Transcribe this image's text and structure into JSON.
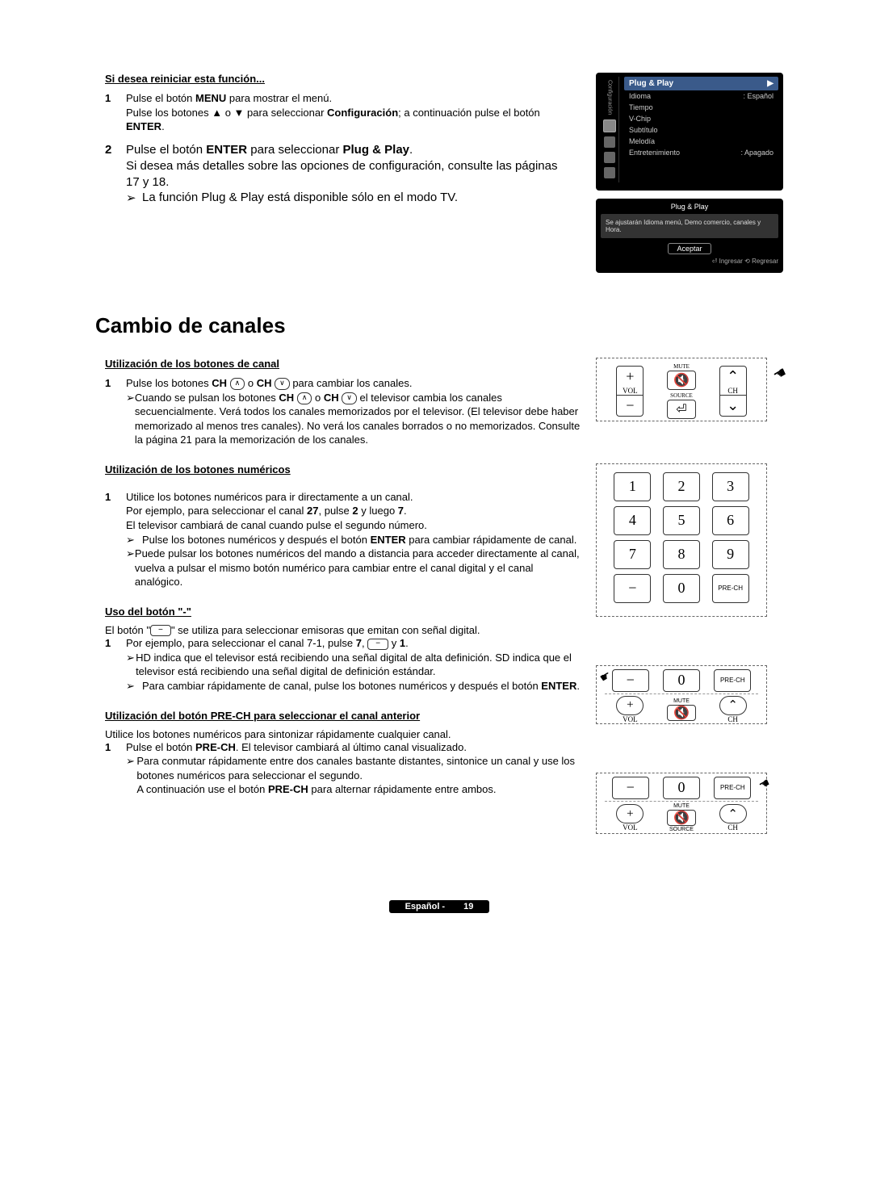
{
  "s1": {
    "heading": "Si desea reiniciar esta función...",
    "step1_num": "1",
    "step1_l1a": "Pulse el botón ",
    "step1_l1b": "MENU",
    "step1_l1c": " para mostrar el menú.",
    "step1_l2a": "Pulse los botones ▲ o ▼ para seleccionar ",
    "step1_l2b": "Configuración",
    "step1_l2c": "; a continuación pulse el botón ",
    "step1_l2d": "ENTER",
    "step1_l2e": ".",
    "step2_num": "2",
    "step2_l1a": "Pulse el botón ",
    "step2_l1b": "ENTER",
    "step2_l1c": " para seleccionar ",
    "step2_l1d": "Plug & Play",
    "step2_l1e": ".",
    "step2_l2": "Si desea más detalles sobre las opciones de configuración, consulte las páginas 17 y 18.",
    "step2_note": "La función Plug & Play está disponible sólo en el modo TV."
  },
  "osd": {
    "sidebar": "Configuración",
    "highlight": "Plug & Play",
    "arrow": "▶",
    "row1a": "Idioma",
    "row1b": ": Español",
    "row2": "Tiempo",
    "row3": "V-Chip",
    "row4": "Subtítulo",
    "row5": "Melodía",
    "row6a": "Entretenimiento",
    "row6b": ": Apagado"
  },
  "osd2": {
    "title": "Plug & Play",
    "msg": "Se ajustarán Idioma menú, Demo comercio, canales y Hora.",
    "btn": "Aceptar",
    "footer": "⏎ Ingresar  ⟲ Regresar"
  },
  "main_heading": "Cambio de canales",
  "s2": {
    "h1": "Utilización de los botones de canal",
    "n1": "1",
    "l1a": "Pulse los botones ",
    "l1b": "CH",
    "l1c": " o ",
    "l1d": "CH",
    "l1e": " para cambiar los canales.",
    "note1a": "Cuando se pulsan los botones ",
    "note1b": "CH",
    "note1c": " o ",
    "note1d": "CH",
    "note1e": " el televisor cambia los canales secuencialmente. Verá todos los canales memorizados por el televisor. (El televisor debe haber memorizado al menos tres canales). No verá los canales borrados o no memorizados. Consulte la página 21 para la memorización de los canales."
  },
  "s3": {
    "h": "Utilización de los botones numéricos",
    "n1": "1",
    "l1": "Utilice los botones numéricos para ir directamente a un canal.",
    "l2a": "Por ejemplo, para seleccionar el canal ",
    "l2b": "27",
    "l2c": ", pulse ",
    "l2d": "2",
    "l2e": " y luego ",
    "l2f": "7",
    "l2g": ".",
    "l3": "El televisor cambiará de canal cuando pulse el segundo número.",
    "a1a": "Pulse los botones numéricos y después el botón ",
    "a1b": "ENTER",
    "a1c": " para cambiar rápidamente de canal.",
    "a2": "Puede pulsar los botones numéricos del mando a distancia para acceder directamente al canal, vuelva a pulsar el mismo botón numérico para cambiar entre el canal digital y el canal analógico."
  },
  "s4": {
    "h": "Uso del botón \"-\"",
    "intro_a": "El botón \"",
    "intro_b": "\" se utiliza para seleccionar emisoras que emitan con señal digital.",
    "n1": "1",
    "l1a": "Por ejemplo, para seleccionar el canal 7-1, pulse ",
    "l1b": "7",
    "l1c": ", ",
    "l1d": " y ",
    "l1e": "1",
    "l1f": ".",
    "a1": "HD indica que el televisor está recibiendo una señal digital de alta definición. SD indica que el televisor está recibiendo una señal digital de definición estándar.",
    "a2a": "Para cambiar rápidamente de canal, pulse los botones numéricos y después el botón ",
    "a2b": "ENTER",
    "a2c": "."
  },
  "s5": {
    "h": "Utilización del botón PRE-CH para seleccionar el canal anterior",
    "intro": "Utilice los botones numéricos para sintonizar rápidamente cualquier canal.",
    "n1": "1",
    "l1a": "Pulse el botón ",
    "l1b": "PRE-CH",
    "l1c": ". El televisor cambiará al último canal visualizado.",
    "a1a": "Para conmutar rápidamente entre dos canales bastante distantes, sintonice un canal y use los botones numéricos para seleccionar el segundo.",
    "a1b": "A continuación use el botón ",
    "a1c": "PRE-CH",
    "a1d": " para alternar rápidamente entre ambos."
  },
  "remote": {
    "mute": "MUTE",
    "vol": "VOL",
    "source": "SOURCE",
    "ch": "CH",
    "prech": "PRE-CH",
    "plus": "+",
    "minus": "−",
    "up": "⌃",
    "down": "⌄",
    "mute_icon": "🔇",
    "enter_icon": "⏎"
  },
  "keypad": {
    "k1": "1",
    "k2": "2",
    "k3": "3",
    "k4": "4",
    "k5": "5",
    "k6": "6",
    "k7": "7",
    "k8": "8",
    "k9": "9",
    "km": "−",
    "k0": "0",
    "kpre": "PRE-CH"
  },
  "footer_a": "Español - ",
  "footer_b": "19",
  "arrow_glyph": "➢"
}
